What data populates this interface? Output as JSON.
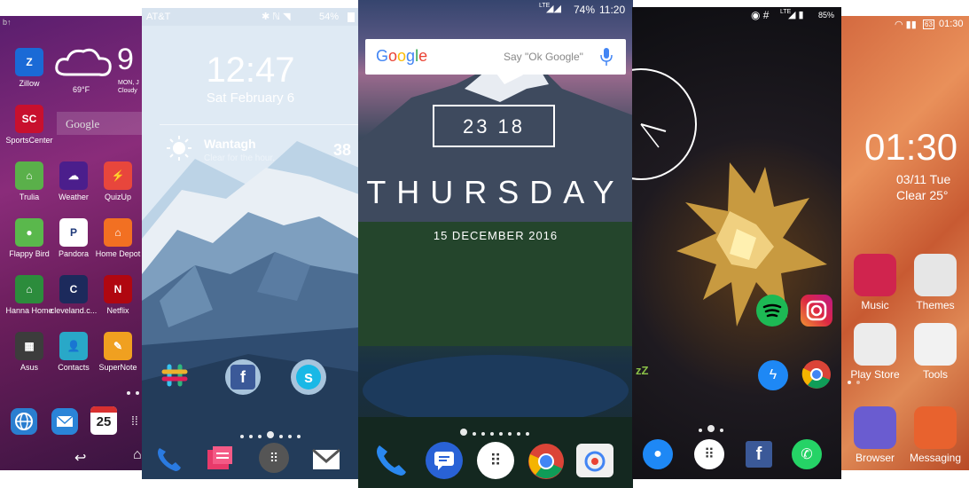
{
  "p1": {
    "statusbar": {
      "left": "b↑"
    },
    "weather": {
      "temp": "69°F",
      "big_temp": "9",
      "date": "MON, J",
      "cond": "Cloudy"
    },
    "search_label": "Google",
    "apps": [
      {
        "label": "Zillow",
        "color": "#1a6ad6",
        "glyph": "Z"
      },
      {
        "label": "SportsCenter",
        "color": "#c8102e",
        "glyph": "SC"
      },
      {
        "label": "Trulia",
        "color": "#5ab04a",
        "glyph": "⌂"
      },
      {
        "label": "Weather",
        "color": "#4b1e8c",
        "glyph": "☁"
      },
      {
        "label": "QuizUp",
        "color": "#e8463c",
        "glyph": "⚡"
      },
      {
        "label": "Flappy Bird",
        "color": "#5ab84c",
        "glyph": "●"
      },
      {
        "label": "Pandora",
        "color": "#ffffff",
        "glyph": "P"
      },
      {
        "label": "Home Depot",
        "color": "#f27022",
        "glyph": "⌂"
      },
      {
        "label": "Hanna Home",
        "color": "#2c8c3c",
        "glyph": "⌂"
      },
      {
        "label": "cleveland.c...",
        "color": "#1c2a5c",
        "glyph": "C"
      },
      {
        "label": "Netflix",
        "color": "#b00710",
        "glyph": "N"
      },
      {
        "label": "Asus",
        "color": "#3c3c3c",
        "glyph": "▦"
      },
      {
        "label": "Contacts",
        "color": "#29a8c8",
        "glyph": "👤"
      },
      {
        "label": "SuperNote",
        "color": "#f0a020",
        "glyph": "✎"
      }
    ],
    "dock_date": "25"
  },
  "p2": {
    "statusbar": {
      "carrier": "AT&T",
      "battery": "54%"
    },
    "clock": "12:47",
    "date": "Sat February 6",
    "weather": {
      "city": "Wantagh",
      "desc": "Clear for the hour.",
      "temp": "38"
    }
  },
  "p3": {
    "statusbar": {
      "battery": "74%",
      "time": "11:20",
      "lte": "LTE"
    },
    "search_logo": "Google",
    "search_hint": "Say \"Ok Google\"",
    "clock": "23 18",
    "day": "THURSDAY",
    "date": "15 DECEMBER 2016"
  },
  "p4": {
    "statusbar": {
      "battery": "85%",
      "lte": "LTE"
    },
    "zz": "zZ"
  },
  "p5": {
    "statusbar": {
      "time": "01:30",
      "battery": "63"
    },
    "clock": "01:30",
    "date": "03/11 Tue",
    "weather": "Clear  25°",
    "apps": [
      {
        "label": "Music",
        "color": "#d0244e"
      },
      {
        "label": "Themes",
        "color": "#e6e6e6"
      },
      {
        "label": "Play Store",
        "color": "#ececec"
      },
      {
        "label": "Tools",
        "color": "#f2f2f2"
      },
      {
        "label": "Browser",
        "color": "#6a5cd0"
      },
      {
        "label": "Messaging",
        "color": "#e8622e"
      }
    ]
  }
}
